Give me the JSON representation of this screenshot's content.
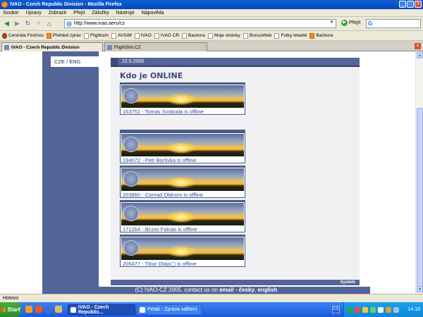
{
  "window": {
    "title": "IVAO - Czech Republic Division - Mozilla Firefox"
  },
  "menu": [
    "Soubor",
    "Úpravy",
    "Zobrazit",
    "Přejít",
    "Záložky",
    "Nástroje",
    "Nápověda"
  ],
  "address": {
    "url": "http://www.ivao.aero/cz",
    "go_label": "Přejít",
    "search_engine": "G"
  },
  "bookmarks": [
    "Centrála Firefoxu",
    "Přehled zpráv",
    "Flightsim",
    "AVSIM",
    "IVAO",
    "IVAO CR",
    "Backora",
    "Moje stránky",
    "BonusWeb",
    "Fotky letadel",
    "Bačkora"
  ],
  "tabs": [
    {
      "label": "IVAO - Czech Republic Division",
      "active": true
    },
    {
      "label": "FlightSim.CZ",
      "active": false
    }
  ],
  "page": {
    "lang_switch": "CZE / ENG",
    "date": "22.5.2006",
    "heading": "Kdo je ONLINE",
    "entries": [
      "163751 - Tomas Svoboda is offline",
      "194072 - Petr Borůvka is offline",
      "203860 - Conrad Oldcorn is offline",
      "171264 - Bruno Falcao is offline",
      "206477 - Tibor Olajo▢ is offline"
    ],
    "footer_label": "System",
    "footer": {
      "prefix": "(C) IVAO-CZ 2005, contact us on ",
      "email": "email",
      "sep1": " - ",
      "cz": "česky",
      "sep2": ", ",
      "en": "english"
    }
  },
  "status": "Hotovo",
  "taskbar": {
    "start": "Start",
    "items": [
      "IVAO - Czech Republic...",
      "Petak - Zpráva sdělení"
    ],
    "lang": "CS",
    "clock": "14:19"
  }
}
